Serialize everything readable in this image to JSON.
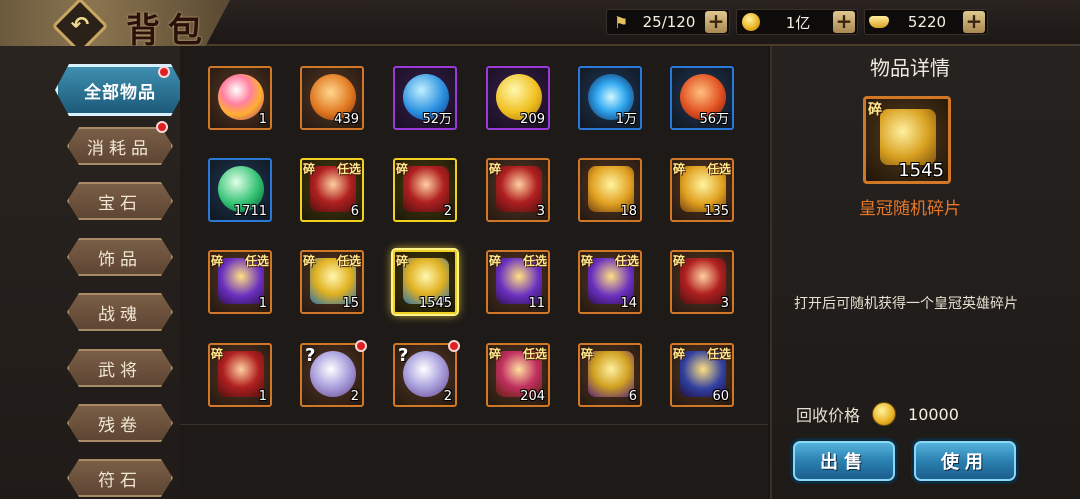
{
  "header": {
    "title": "背包",
    "resources": [
      {
        "icon": "trophy-flag-icon",
        "value": "25/120"
      },
      {
        "icon": "gold-coin-icon",
        "value": "1亿"
      },
      {
        "icon": "gold-ingot-icon",
        "value": "5220"
      }
    ]
  },
  "sidebar": {
    "tabs": [
      {
        "label": "全部物品",
        "active": true,
        "badge": true
      },
      {
        "label": "消耗品",
        "badge": true
      },
      {
        "label": "宝石"
      },
      {
        "label": "饰品"
      },
      {
        "label": "战魂"
      },
      {
        "label": "武将"
      },
      {
        "label": "残卷"
      },
      {
        "label": "符石"
      }
    ]
  },
  "grid": {
    "items": [
      {
        "icon": "rainbow-gem-icon",
        "count": "1",
        "quality": "orange"
      },
      {
        "icon": "orange-crystal-icon",
        "count": "439",
        "quality": "orange"
      },
      {
        "icon": "blue-lightning-egg-icon",
        "count": "52万",
        "quality": "purple"
      },
      {
        "icon": "gold-wing-coin-icon",
        "count": "209",
        "quality": "purple"
      },
      {
        "icon": "blue-flame-spirit-icon",
        "count": "1万",
        "quality": "blue"
      },
      {
        "icon": "red-ore-icon",
        "count": "56万",
        "quality": "blue"
      },
      {
        "icon": "green-gem-icon",
        "count": "1711",
        "quality": "blue"
      },
      {
        "icon": "red-chest-icon",
        "count": "6",
        "quality": "yellow",
        "frag": "碎",
        "opt": "任选"
      },
      {
        "icon": "red-chest-icon",
        "count": "2",
        "quality": "yellow",
        "frag": "碎"
      },
      {
        "icon": "red-chest-icon",
        "count": "3",
        "quality": "orange",
        "frag": "碎"
      },
      {
        "icon": "gold-chest-icon",
        "count": "18",
        "quality": "orange"
      },
      {
        "icon": "gold-chest-icon",
        "count": "135",
        "quality": "orange",
        "frag": "碎",
        "opt": "任选"
      },
      {
        "icon": "purple-crown-chest-icon",
        "count": "1",
        "quality": "orange",
        "frag": "碎",
        "opt": "任选"
      },
      {
        "icon": "gold-crown-chest-icon",
        "count": "15",
        "quality": "orange",
        "frag": "碎",
        "opt": "任选"
      },
      {
        "icon": "gold-crown-chest-icon",
        "count": "1545",
        "quality": "yellow",
        "frag": "碎",
        "selected": true
      },
      {
        "icon": "purple-crown-chest-icon",
        "count": "11",
        "quality": "orange",
        "frag": "碎",
        "opt": "任选"
      },
      {
        "icon": "purple-crown-chest-icon",
        "count": "14",
        "quality": "orange",
        "frag": "碎",
        "opt": "任选"
      },
      {
        "icon": "red-chest-icon",
        "count": "3",
        "quality": "orange",
        "frag": "碎"
      },
      {
        "icon": "red-chest-icon",
        "count": "1",
        "quality": "orange",
        "frag": "碎"
      },
      {
        "icon": "mystery-crystal-icon",
        "count": "2",
        "quality": "orange",
        "qmark": "?",
        "badge": true
      },
      {
        "icon": "mystery-crystal-icon",
        "count": "2",
        "quality": "orange",
        "qmark": "?",
        "badge": true
      },
      {
        "icon": "ornate-chest-icon",
        "count": "204",
        "quality": "orange",
        "frag": "碎",
        "opt": "任选"
      },
      {
        "icon": "gold-purple-chest-icon",
        "count": "6",
        "quality": "orange",
        "frag": "碎"
      },
      {
        "icon": "blue-gold-chest-icon",
        "count": "60",
        "quality": "orange",
        "frag": "碎",
        "opt": "任选"
      }
    ]
  },
  "detail": {
    "title": "物品详情",
    "frag": "碎",
    "count": "1545",
    "name": "皇冠随机碎片",
    "description": "打开后可随机获得一个皇冠英雄碎片",
    "recycle_label": "回收价格",
    "recycle_value": "10000",
    "sell_label": "出售",
    "use_label": "使用"
  }
}
